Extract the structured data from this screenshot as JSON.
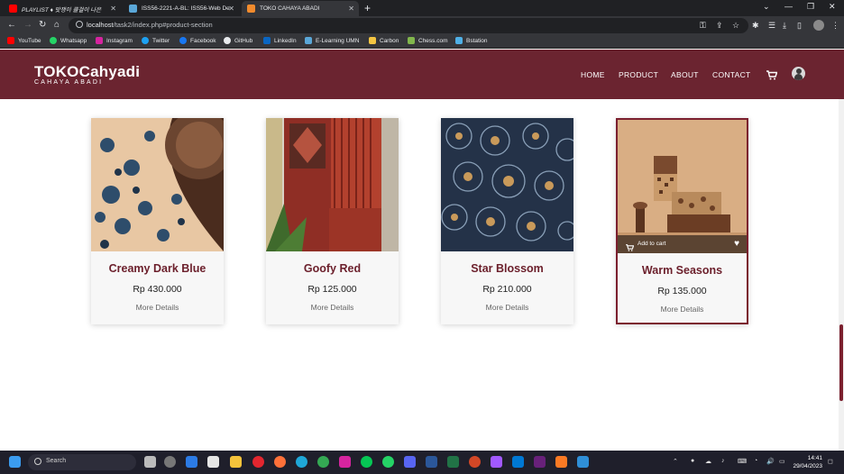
{
  "browser": {
    "tabs": [
      {
        "label": "PLAYLIST ♦ 맛쟁이 클걸이 나은",
        "color": "#ff0000"
      },
      {
        "label": "ISS56-2221-A-BL: ISS56-Web De",
        "color": "#5aa7d8"
      },
      {
        "label": "TOKO CAHAYA ABADI",
        "color": "#f28b2d"
      }
    ],
    "url_host": "localhost",
    "url_path": "/task2/index.php#product-section",
    "bookmarks": [
      {
        "label": "YouTube",
        "color": "#ff0000"
      },
      {
        "label": "Whatsapp",
        "color": "#25d366"
      },
      {
        "label": "Instagram",
        "color": "#d6249f"
      },
      {
        "label": "Twitter",
        "color": "#1da1f2"
      },
      {
        "label": "Facebook",
        "color": "#1877f2"
      },
      {
        "label": "GitHub",
        "color": "#e8eaed"
      },
      {
        "label": "LinkedIn",
        "color": "#0a66c2"
      },
      {
        "label": "E-Learning UMN",
        "color": "#5aa7d8"
      },
      {
        "label": "Carbon",
        "color": "#f4c542"
      },
      {
        "label": "Chess.com",
        "color": "#81b64c"
      },
      {
        "label": "Bstation",
        "color": "#4fb0e6"
      }
    ]
  },
  "site": {
    "logo": "TOKOCahyadi",
    "tagline": "CAHAYA ABADI",
    "nav": [
      "HOME",
      "PRODUCT",
      "ABOUT",
      "CONTACT"
    ],
    "accent": "#6b2430"
  },
  "products": [
    {
      "name": "Creamy Dark Blue",
      "price": "Rp 430.000",
      "details": "More Details"
    },
    {
      "name": "Goofy Red",
      "price": "Rp 125.000",
      "details": "More Details"
    },
    {
      "name": "Star Blossom",
      "price": "Rp 210.000",
      "details": "More Details"
    },
    {
      "name": "Warm Seasons",
      "price": "Rp 135.000",
      "details": "More Details",
      "add_to_cart": "Add to cart"
    }
  ],
  "taskbar": {
    "search": "Search",
    "time": "14:41",
    "date": "29/04/2023"
  }
}
